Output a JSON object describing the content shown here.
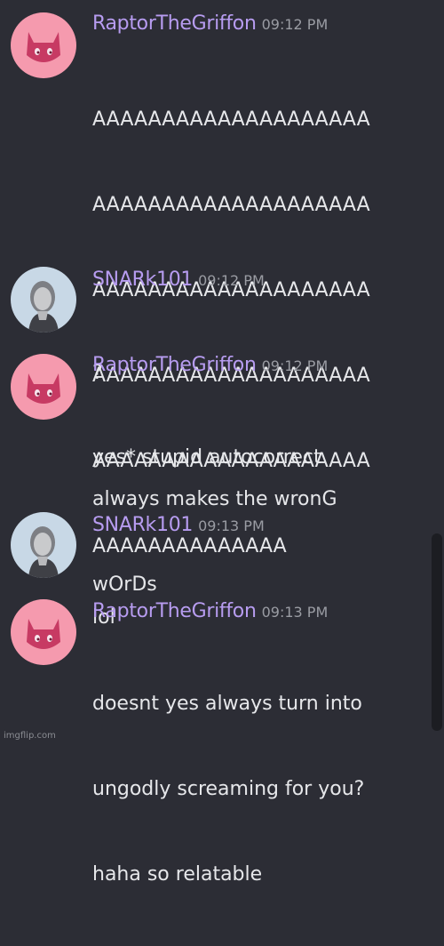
{
  "messages": [
    {
      "username": "RaptorTheGriffon",
      "time": "09:12 PM",
      "avatar": "pink-cat-avatar",
      "lines": [
        "AAAAAAAAAAAAAAAAAAAA",
        "AAAAAAAAAAAAAAAAAAAA",
        "AAAAAAAAAAAAAAAAAAAA",
        "AAAAAAAAAAAAAAAAAAAA",
        "AAAAAAAAAAAAAAAAAAAA",
        "AAAAAAAAAAAAAA"
      ]
    },
    {
      "username": "SNARk101",
      "time": "09:12 PM",
      "avatar": "statue-avatar",
      "lines": [
        "?"
      ]
    },
    {
      "username": "RaptorTheGriffon",
      "time": "09:12 PM",
      "avatar": "pink-cat-avatar",
      "lines": [
        "yes* stupid autocorrect"
      ],
      "followup": [
        "always makes the wronG",
        "wOrDs"
      ]
    },
    {
      "username": "SNARk101",
      "time": "09:13 PM",
      "avatar": "statue-avatar",
      "lines": [
        "lol"
      ]
    },
    {
      "username": "RaptorTheGriffon",
      "time": "09:13 PM",
      "avatar": "pink-cat-avatar",
      "lines": [
        "doesnt yes always turn into",
        "ungodly screaming for you?",
        "haha so relatable"
      ]
    }
  ],
  "watermark": "imgflip.com",
  "colors": {
    "background": "#2c2d35",
    "username": "#b79cf0",
    "text": "#e6e7ea",
    "timestamp": "#9a9ca3"
  }
}
